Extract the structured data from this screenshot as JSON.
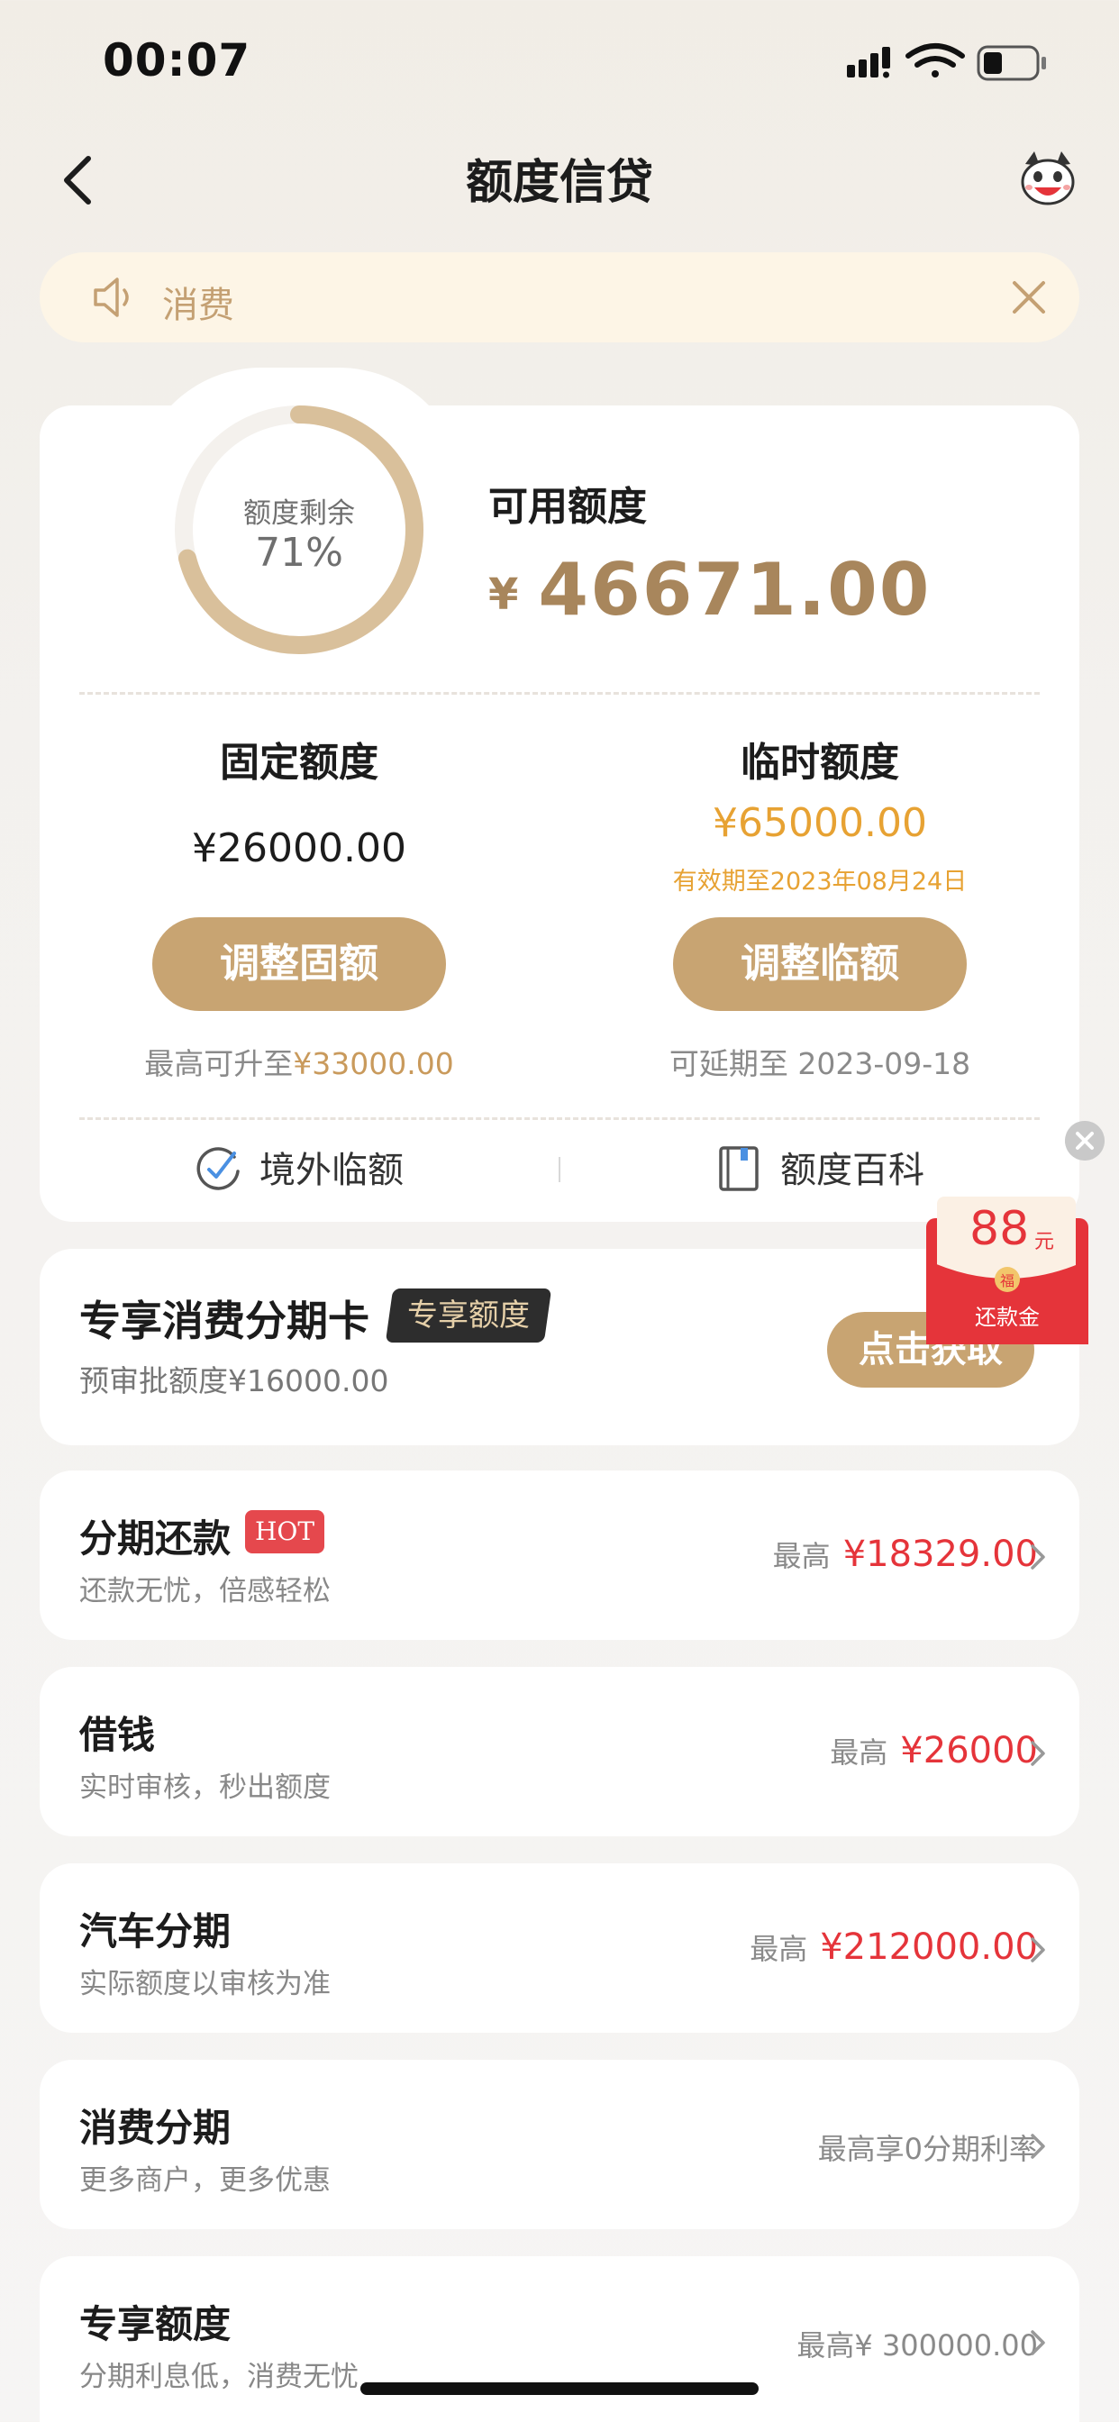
{
  "status": {
    "time": "00:07"
  },
  "nav": {
    "title": "额度信贷"
  },
  "notice": {
    "text": "消费"
  },
  "credit": {
    "ring_label": "额度剩余",
    "ring_pct": "71%",
    "ring_fraction": 0.71,
    "available_label": "可用额度",
    "currency": "¥",
    "available_amount": "46671.00",
    "fixed": {
      "title": "固定额度",
      "amount": "¥26000.00",
      "button": "调整固额",
      "note_prefix": "最高可升至",
      "note_value": "¥33000.00"
    },
    "temp": {
      "title": "临时额度",
      "amount": "¥65000.00",
      "valid": "有效期至2023年08月24日",
      "button": "调整临额",
      "note": "可延期至 2023-09-18"
    },
    "links": [
      {
        "label": "境外临额",
        "icon": "check-circle-icon"
      },
      {
        "label": "额度百科",
        "icon": "book-icon"
      }
    ]
  },
  "redpack": {
    "amount": "88",
    "unit": "元",
    "label": "还款金",
    "seal": "福"
  },
  "exclusive": {
    "title": "专享消费分期卡",
    "tag": "专享额度",
    "sub": "预审批额度¥16000.00",
    "button": "点击获取"
  },
  "items": [
    {
      "title": "分期还款",
      "badge": "HOT",
      "sub": "还款无忧，倍感轻松",
      "right_label": "最高",
      "right_amount": "¥18329.00"
    },
    {
      "title": "借钱",
      "sub": "实时审核，秒出额度",
      "right_label": "最高",
      "right_amount": "¥26000"
    },
    {
      "title": "汽车分期",
      "sub": "实际额度以审核为准",
      "right_label": "最高",
      "right_amount": "¥212000.00"
    },
    {
      "title": "消费分期",
      "sub": "更多商户，更多优惠",
      "right_label": "最高享0分期利率",
      "right_amount": ""
    },
    {
      "title": "专享额度",
      "sub": "分期利息低，消费无忧",
      "right_label": "最高¥ 300000.00",
      "right_amount": ""
    }
  ],
  "colors": {
    "gold": "#c8a472",
    "amount_gold": "#a8865c",
    "orange": "#e7a233",
    "red": "#e5343a"
  }
}
